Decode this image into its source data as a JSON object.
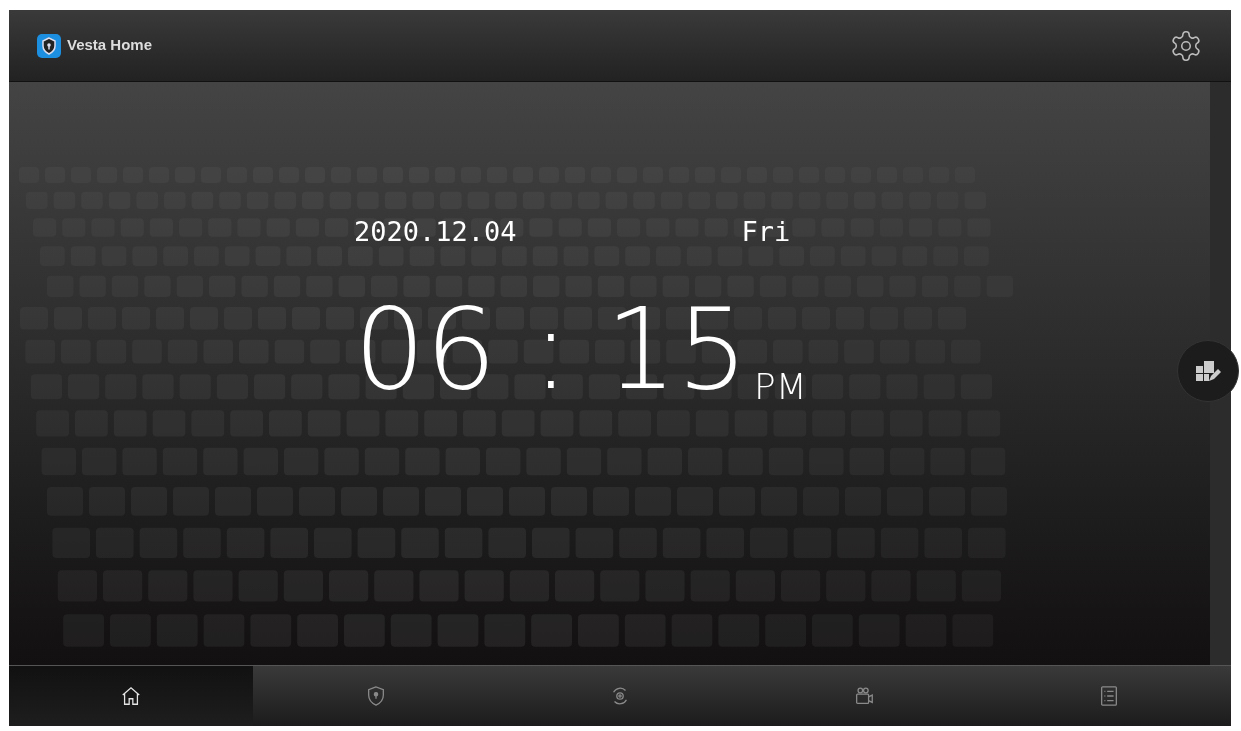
{
  "header": {
    "title": "Vesta Home"
  },
  "clock": {
    "date": "2020.12.04",
    "weekday": "Fri",
    "time": "06 : 15",
    "period": "PM"
  },
  "nav": [
    {
      "kind": "home",
      "selected": true
    },
    {
      "kind": "shield",
      "selected": false
    },
    {
      "kind": "cycle",
      "selected": false
    },
    {
      "kind": "camera",
      "selected": false
    },
    {
      "kind": "list",
      "selected": false
    }
  ]
}
